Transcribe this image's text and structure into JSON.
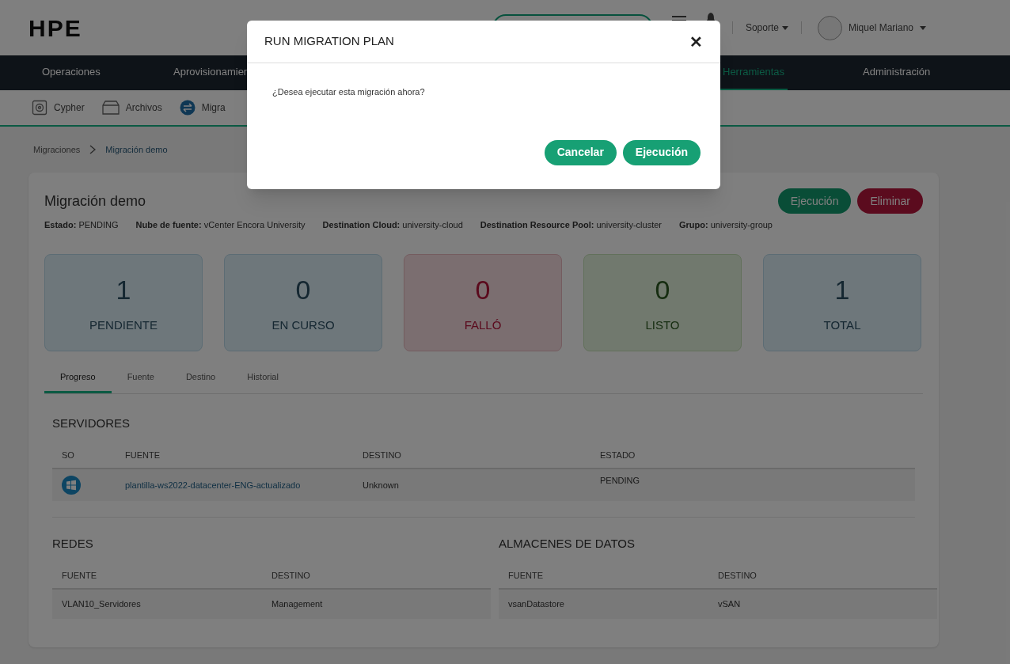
{
  "header": {
    "logo": "HPE",
    "support": "Soporte",
    "user": "Miquel Mariano"
  },
  "nav": [
    {
      "label": "Operaciones",
      "selected": false
    },
    {
      "label": "Aprovisionamien",
      "selected": false
    },
    {
      "label": "Herramientas",
      "selected": true
    },
    {
      "label": "Administración",
      "selected": false
    }
  ],
  "subnav": [
    {
      "label": "Cypher",
      "kind": "safe"
    },
    {
      "label": "Archivos",
      "kind": "folder"
    },
    {
      "label": "Migra",
      "kind": "migrate"
    }
  ],
  "breadcrumb": [
    "Migraciones",
    "Migración demo"
  ],
  "plan": {
    "title": "Migración demo",
    "actions": [
      {
        "label": "Ejecución",
        "kind": "primary"
      },
      {
        "label": "Eliminar",
        "kind": "danger"
      }
    ],
    "info": [
      {
        "label": "Estado:",
        "value": "PENDING"
      },
      {
        "label": "Nube de fuente:",
        "value": "vCenter Encora University"
      },
      {
        "label": "Destination Cloud:",
        "value": "university-cloud"
      },
      {
        "label": "Destination Resource Pool:",
        "value": "university-cluster"
      },
      {
        "label": "Grupo:",
        "value": "university-group"
      }
    ]
  },
  "stats": [
    {
      "value": "1",
      "label": "PENDIENTE",
      "kind": "blue"
    },
    {
      "value": "0",
      "label": "EN CURSO",
      "kind": "blue"
    },
    {
      "value": "0",
      "label": "FALLÓ",
      "kind": "red"
    },
    {
      "value": "0",
      "label": "LISTO",
      "kind": "green"
    },
    {
      "value": "1",
      "label": "TOTAL",
      "kind": "blue"
    }
  ],
  "tabs": [
    {
      "label": "Progreso",
      "selected": true
    },
    {
      "label": "Fuente",
      "selected": false
    },
    {
      "label": "Destino",
      "selected": false
    },
    {
      "label": "Historial",
      "selected": false
    }
  ],
  "servers": {
    "title": "SERVIDORES",
    "columns": [
      "SO",
      "FUENTE",
      "DESTINO",
      "ESTADO"
    ],
    "rows": [
      {
        "kind": "windows",
        "source": "plantilla-ws2022-datacenter-ENG-actualizado",
        "destination": "Unknown",
        "status": "PENDING"
      }
    ]
  },
  "networks": {
    "title": "REDES",
    "columns": [
      "FUENTE",
      "DESTINO"
    ],
    "rows": [
      [
        "VLAN10_Servidores",
        "Management"
      ]
    ]
  },
  "datastores": {
    "title": "ALMACENES DE DATOS",
    "columns": [
      "FUENTE",
      "DESTINO"
    ],
    "rows": [
      [
        "vsanDatastore",
        "vSAN"
      ]
    ]
  },
  "modal": {
    "title": "RUN MIGRATION PLAN",
    "close": "✕",
    "message": "¿Desea ejecutar esta migración ahora?",
    "buttons": [
      "Cancelar",
      "Ejecución"
    ]
  }
}
